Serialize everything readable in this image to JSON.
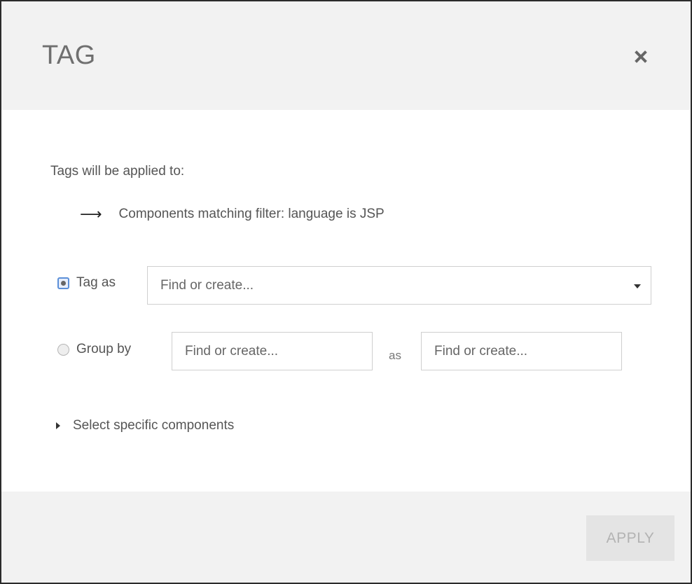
{
  "dialog": {
    "title": "TAG",
    "close_icon": "close-icon"
  },
  "body": {
    "applied_label": "Tags will be applied to:",
    "arrow_icon": "arrow-right-icon",
    "target_text": "Components matching filter: language is JSP",
    "tag_as": {
      "label": "Tag as",
      "selected": true,
      "placeholder": "Find or create..."
    },
    "group_by": {
      "label": "Group by",
      "selected": false,
      "placeholder_first": "Find or create...",
      "as_label": "as",
      "placeholder_second": "Find or create..."
    },
    "select_specific": "Select specific components"
  },
  "footer": {
    "apply_label": "APPLY",
    "apply_enabled": false
  },
  "colors": {
    "header_bg": "#f2f2f2",
    "footer_bg": "#f2f2f2",
    "radio_focus": "#5b8fd8",
    "disabled_button": "#e4e4e4"
  }
}
